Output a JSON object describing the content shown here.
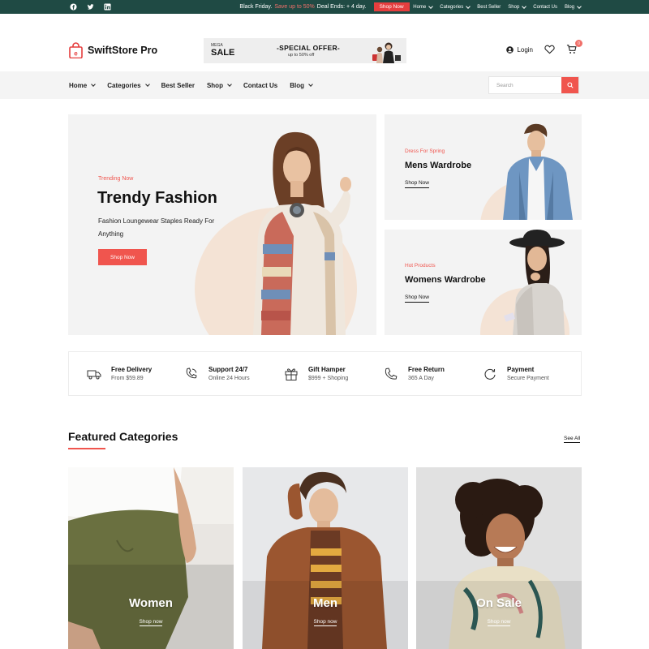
{
  "topbar": {
    "promo_prefix": "Black Friday.",
    "promo_highlight": "Save up to 50%",
    "promo_suffix": "Deal Ends: + 4 day.",
    "shop_now": "Shop Now",
    "nav": [
      "Home",
      "Categories",
      "Best Seller",
      "Shop",
      "Contact Us",
      "Blog"
    ],
    "social_icons": [
      "facebook-icon",
      "twitter-icon",
      "linkedin-icon"
    ]
  },
  "header": {
    "brand": "SwiftStore Pro",
    "banner": {
      "mega": "MEGA",
      "sale": "SALE",
      "offer": "-SPECIAL OFFER-",
      "upto": "up to 50% off"
    },
    "login": "Login",
    "cart_count": "0"
  },
  "nav": {
    "items": [
      "Home",
      "Categories",
      "Best Seller",
      "Shop",
      "Contact Us",
      "Blog"
    ],
    "search_placeholder": "Search"
  },
  "hero": {
    "main": {
      "tag": "Trending Now",
      "title": "Trendy Fashion",
      "subtitle": "Fashion Loungewear Staples Ready For Anything",
      "button": "Shop Now"
    },
    "side": [
      {
        "tag": "Dress For Spring",
        "title": "Mens Wardrobe",
        "link": "Shop Now"
      },
      {
        "tag": "Hot Products",
        "title": "Womens Wardrobe",
        "link": "Shop Now"
      }
    ]
  },
  "features": [
    {
      "icon": "truck-icon",
      "title": "Free Delivery",
      "sub": "From $59.89"
    },
    {
      "icon": "phone-support-icon",
      "title": "Support 24/7",
      "sub": "Online 24 Hours"
    },
    {
      "icon": "gift-icon",
      "title": "Gift Hamper",
      "sub": "$999 + Shoping"
    },
    {
      "icon": "phone-icon",
      "title": "Free Return",
      "sub": "365 A Day"
    },
    {
      "icon": "refresh-icon",
      "title": "Payment",
      "sub": "Secure Payment"
    }
  ],
  "featured": {
    "title": "Featured Categories",
    "see_all": "See All",
    "categories": [
      {
        "label": "Women",
        "link": "Shop now"
      },
      {
        "label": "Men",
        "link": "Shop now"
      },
      {
        "label": "On Sale",
        "link": "Shop now"
      }
    ]
  },
  "colors": {
    "topbar_bg": "#1f4a44",
    "accent": "#f0554e",
    "nav_bg": "#f4f4f4",
    "card_bg": "#f3f3f3",
    "peach": "#f4e3d5"
  }
}
